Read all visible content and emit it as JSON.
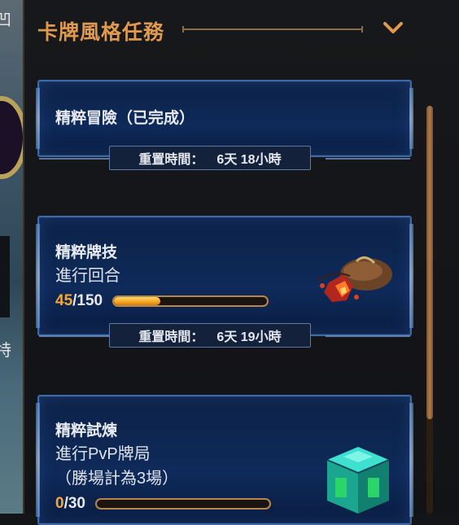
{
  "background": {
    "left_text_1": "凹",
    "left_text_2": "特"
  },
  "header": {
    "title": "卡牌風格任務",
    "accent_color": "#e09a4f"
  },
  "quests": [
    {
      "name": "精粹冒險（已完成）",
      "reset_label": "重置時間：",
      "reset_value": "6天  18小時"
    },
    {
      "name": "精粹牌技",
      "subtitle": "進行回合",
      "progress_current": "45",
      "progress_total": "/150",
      "progress_fraction": 0.3,
      "reward_icon": "ember-pouch-icon",
      "reset_label": "重置時間：",
      "reset_value": "6天  19小時"
    },
    {
      "name": "精粹試煉",
      "subtitle": "進行PvP牌局",
      "subtitle_2": "（勝場計為3場）",
      "progress_current": "0",
      "progress_total": "/30",
      "progress_fraction": 0.0,
      "reward_icon": "emerald-chest-icon"
    }
  ]
}
